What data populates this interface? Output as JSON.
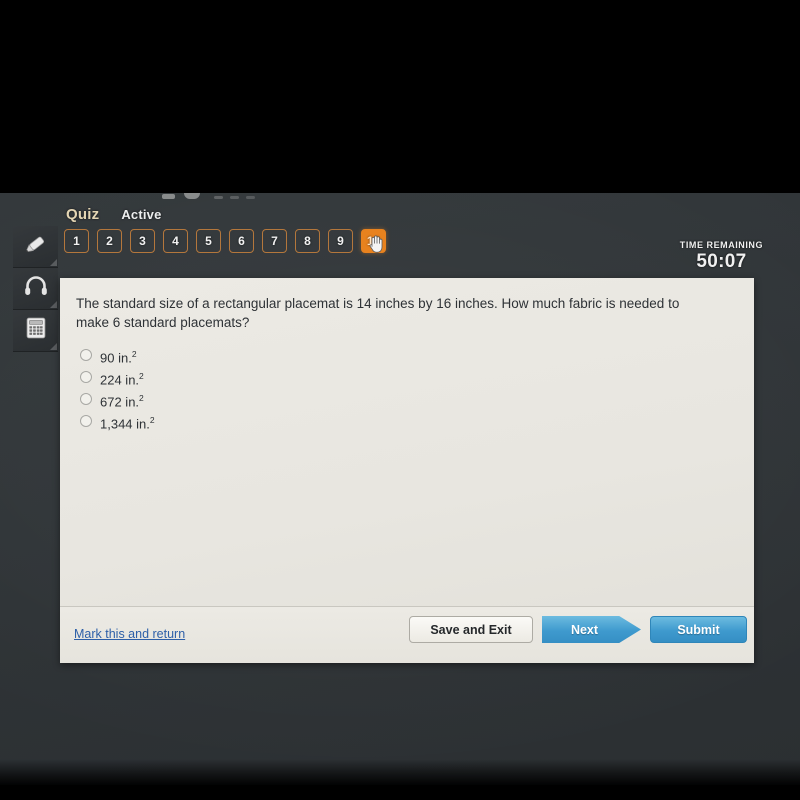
{
  "header": {
    "quiz_title": "Quiz",
    "status": "Active"
  },
  "tool_rail": {
    "items": [
      {
        "icon": "highlighter-icon",
        "name": "highlighter"
      },
      {
        "icon": "headphones-icon",
        "name": "headphones"
      },
      {
        "icon": "calculator-icon",
        "name": "calculator"
      }
    ]
  },
  "question_tabs": {
    "numbers": [
      "1",
      "2",
      "3",
      "4",
      "5",
      "6",
      "7",
      "8",
      "9",
      "10"
    ],
    "active_index": 9,
    "cursor_icon": "hand-pointer-icon"
  },
  "timer": {
    "label": "TIME REMAINING",
    "value": "50:07"
  },
  "question": {
    "text": "The standard size of a rectangular placemat is 14 inches by 16 inches. How much fabric is needed to make 6 standard placemats?",
    "options": [
      {
        "value": "90 in.",
        "exponent": "2",
        "selected": false
      },
      {
        "value": "224 in.",
        "exponent": "2",
        "selected": false
      },
      {
        "value": "672 in.",
        "exponent": "2",
        "selected": false
      },
      {
        "value": "1,344 in.",
        "exponent": "2",
        "selected": false
      }
    ]
  },
  "footer": {
    "mark_link": "Mark this and return",
    "save_and_exit": "Save and Exit",
    "next": "Next",
    "submit": "Submit"
  },
  "colors": {
    "accent_orange": "#e8821e",
    "button_blue": "#3f9ace",
    "link_blue": "#2d5fa8",
    "chrome_dark": "#32373a",
    "card_background": "#eceae4",
    "quiz_title": "#e4d6b4"
  }
}
